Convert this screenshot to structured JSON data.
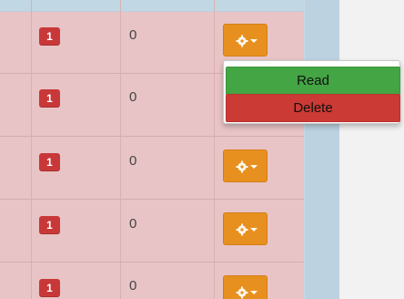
{
  "table": {
    "rows": [
      {
        "badge": "1",
        "count": "0"
      },
      {
        "badge": "1",
        "count": "0"
      },
      {
        "badge": "1",
        "count": "0"
      },
      {
        "badge": "1",
        "count": "0"
      },
      {
        "badge": "1",
        "count": "0"
      }
    ]
  },
  "actions_menu": {
    "read_label": "Read",
    "delete_label": "Delete"
  },
  "icons": {
    "action_button": "gear-icon",
    "action_caret": "caret-down-icon"
  },
  "colors": {
    "row_background": "#e8c4c6",
    "badge": "#c93838",
    "action_button": "#e8901f",
    "read": "#43a543",
    "delete": "#cc3a35",
    "side_band": "#bcd2e0"
  }
}
